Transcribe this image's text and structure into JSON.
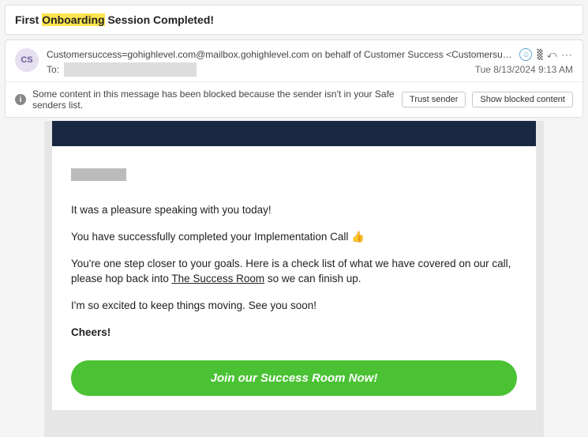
{
  "subject": {
    "prefix": "First ",
    "highlighted": "Onboarding",
    "suffix": " Session Completed!"
  },
  "header": {
    "avatar_initials": "CS",
    "sender_text": "Customersuccess=gohighlevel.com@mailbox.gohighlevel.com on behalf of Customer Success <Customersuccess@gohighlevel",
    "reply_actions": "␩ ⤺ ···",
    "to_label": "To:",
    "timestamp": "Tue 8/13/2024 9:13 AM"
  },
  "blocked": {
    "message": "Some content in this message has been blocked because the sender isn't in your Safe senders list.",
    "trust_label": "Trust sender",
    "show_label": "Show blocked content"
  },
  "email": {
    "p1": "It was a pleasure speaking with you today!",
    "p2_a": "You have successfully completed your Implementation Call ",
    "p2_b": "👍",
    "p3_a": "You're one step closer to your goals. Here is a check list of what we have covered on our call, please hop back into ",
    "p3_link": "The Success Room",
    "p3_b": " so we can finish up.",
    "p4": "I'm so excited to keep things moving. See you soon!",
    "p5": "Cheers!",
    "cta": "Join our Success Room Now!"
  }
}
